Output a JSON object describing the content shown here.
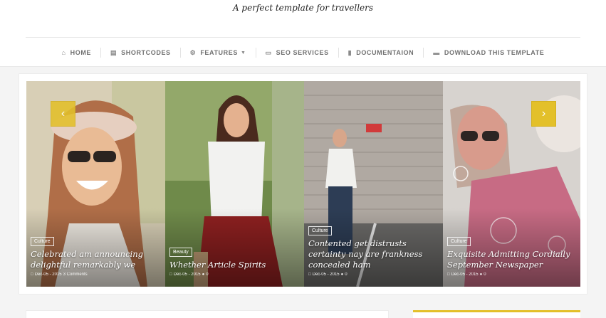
{
  "header": {
    "tagline": "A perfect template for travellers"
  },
  "nav": {
    "items": [
      {
        "label": "HOME",
        "icon": "home-icon"
      },
      {
        "label": "SHORTCODES",
        "icon": "file-icon"
      },
      {
        "label": "FEATURES",
        "icon": "gear-icon",
        "dropdown": true
      },
      {
        "label": "SEO SERVICES",
        "icon": "laptop-icon"
      },
      {
        "label": "DOCUMENTAION",
        "icon": "book-icon"
      },
      {
        "label": "DOWNLOAD THIS TEMPLATE",
        "icon": "download-icon"
      }
    ]
  },
  "slider": {
    "prev_icon": "chevron-left-icon",
    "next_icon": "chevron-right-icon",
    "slides": [
      {
        "category": "Culture",
        "title": "Celebrated am announcing delightful remarkably we",
        "date": "Dec-05 - 2015",
        "comments": "3 Comments"
      },
      {
        "category": "Beauty",
        "title": "Whether Article Spirits",
        "date": "Dec-05 - 2015",
        "comments": "0"
      },
      {
        "category": "Culture",
        "title": "Contented get distrusts certainty nay are frankness concealed ham",
        "date": "Dec-05 - 2015",
        "comments": "0"
      },
      {
        "category": "Culture",
        "title": "Exquisite Admitting Cordially September Newspaper",
        "date": "Dec-05 - 2015",
        "comments": "0"
      }
    ]
  },
  "colors": {
    "accent": "#e3c02a",
    "nav_text": "#707070"
  }
}
